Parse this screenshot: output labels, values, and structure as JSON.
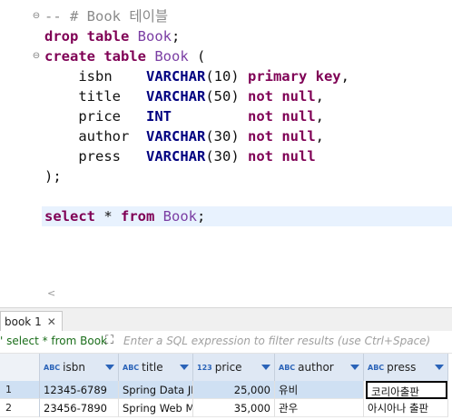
{
  "editor": {
    "lines": {
      "comment": "-- # Book 테이블",
      "drop_kw": "drop table",
      "drop_tbl": "Book",
      "drop_end": ";",
      "create_kw": "create table",
      "create_tbl": "Book",
      "create_open": " (",
      "col1_name": "isbn",
      "col1_type": "VARCHAR",
      "col1_len": "(10)",
      "col1_cons": "primary key",
      "col1_end": ",",
      "col2_name": "title",
      "col2_type": "VARCHAR",
      "col2_len": "(50)",
      "col2_cons": "not null",
      "col2_end": ",",
      "col3_name": "price",
      "col3_type": "INT",
      "col3_cons": "not null",
      "col3_end": ",",
      "col4_name": "author",
      "col4_type": "VARCHAR",
      "col4_len": "(30)",
      "col4_cons": "not null",
      "col4_end": ",",
      "col5_name": "press",
      "col5_type": "VARCHAR",
      "col5_len": "(30)",
      "col5_cons": "not null",
      "close": ");",
      "select_kw": "select",
      "select_star": " * ",
      "from_kw": "from",
      "select_tbl": "Book",
      "select_end": ";"
    }
  },
  "results_tab": {
    "label": "book 1"
  },
  "filter": {
    "query_label": "' select * from Book",
    "placeholder": "Enter a SQL expression to filter results (use Ctrl+Space)"
  },
  "grid": {
    "columns": [
      {
        "type_icon": "ABC 123",
        "label": "isbn"
      },
      {
        "type_icon": "ABC",
        "label": "title"
      },
      {
        "type_icon": "123",
        "label": "price"
      },
      {
        "type_icon": "ABC",
        "label": "author"
      },
      {
        "type_icon": "ABC",
        "label": "press"
      }
    ],
    "rows": [
      {
        "num": "1",
        "isbn": "12345-6789",
        "title": "Spring Data JPA",
        "price": "25,000",
        "author": "유비",
        "press": "코리아출판"
      },
      {
        "num": "2",
        "isbn": "23456-7890",
        "title": "Spring Web MVC",
        "price": "35,000",
        "author": "관우",
        "press": "아시아나 출판"
      }
    ]
  }
}
